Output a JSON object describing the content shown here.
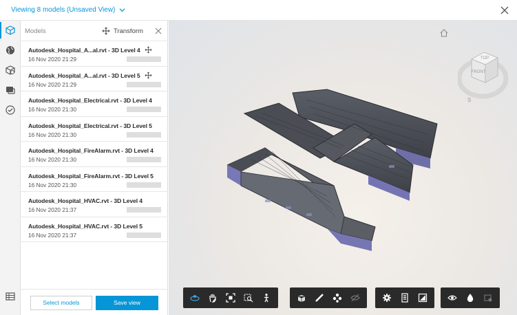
{
  "header": {
    "view_title": "Viewing 8 models (Unsaved View)"
  },
  "rail": {
    "icons": [
      "cube-icon",
      "globe-icon",
      "layers-icon",
      "comments-icon",
      "check-circle-icon",
      "table-icon"
    ]
  },
  "panel": {
    "models_label": "Models",
    "transform_label": "Transform",
    "items": [
      {
        "name": "Autodesk_Hospital_A...al.rvt - 3D Level 4",
        "date": "16 Nov 2020 21:29"
      },
      {
        "name": "Autodesk_Hospital_A...al.rvt - 3D Level 5",
        "date": "16 Nov 2020 21:29"
      },
      {
        "name": "Autodesk_Hospital_Electrical.rvt - 3D Level 4",
        "date": "16 Nov 2020 21:30"
      },
      {
        "name": "Autodesk_Hospital_Electrical.rvt - 3D Level 5",
        "date": "16 Nov 2020 21:30"
      },
      {
        "name": "Autodesk_Hospital_FireAlarm.rvt - 3D Level 4",
        "date": "16 Nov 2020 21:30"
      },
      {
        "name": "Autodesk_Hospital_FireAlarm.rvt - 3D Level 5",
        "date": "16 Nov 2020 21:30"
      },
      {
        "name": "Autodesk_Hospital_HVAC.rvt - 3D Level 4",
        "date": "16 Nov 2020 21:37"
      },
      {
        "name": "Autodesk_Hospital_HVAC.rvt - 3D Level 5",
        "date": "16 Nov 2020 21:37"
      }
    ],
    "select_models_label": "Select models",
    "save_view_label": "Save view"
  },
  "viewcube": {
    "top_label": "TOP",
    "front_label": "FRONT",
    "compass_label": "S"
  },
  "colors": {
    "accent": "#0696d7",
    "toolbar_bg": "#2a2a2a"
  }
}
